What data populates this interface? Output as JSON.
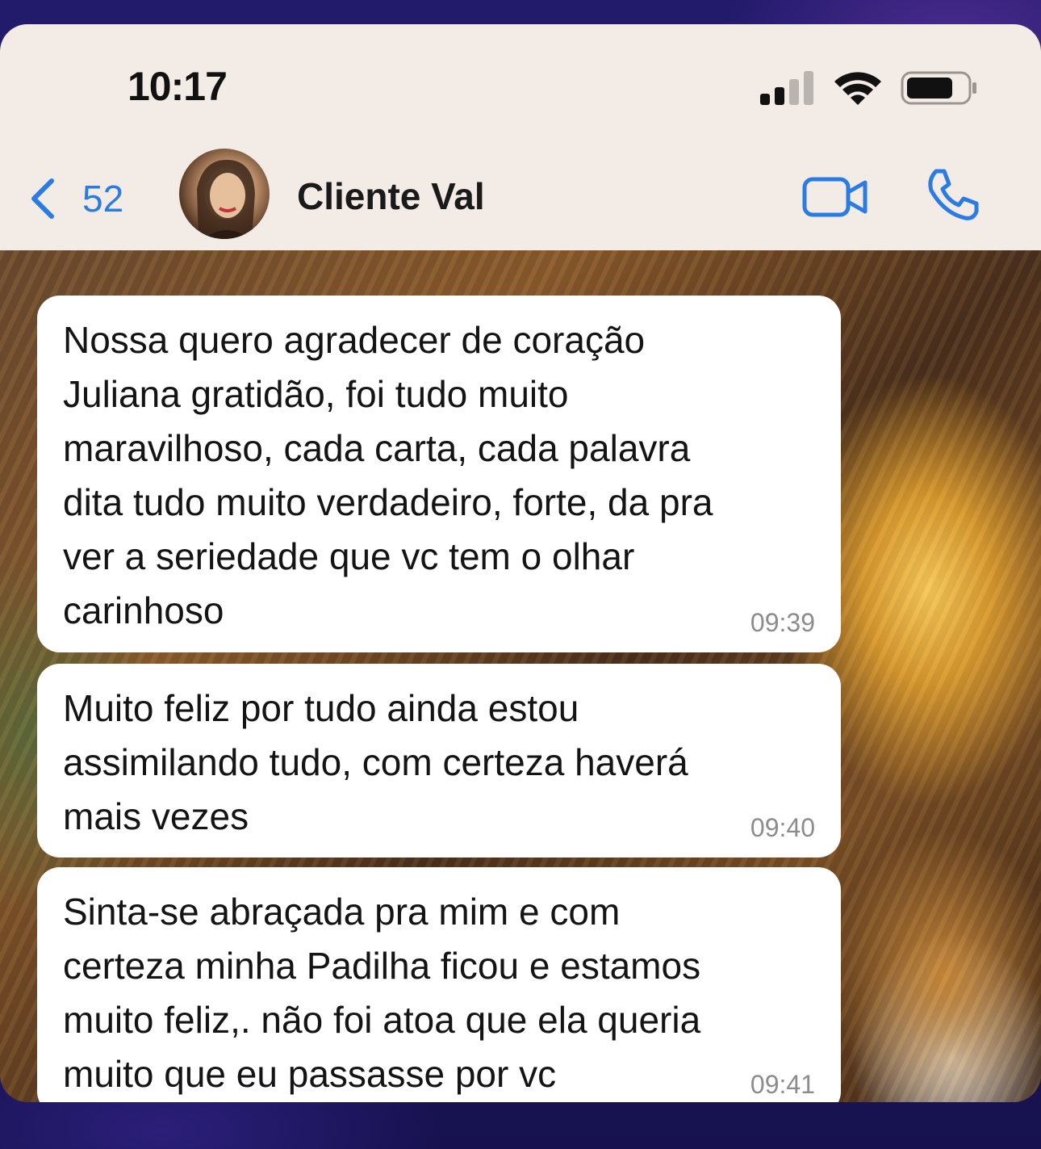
{
  "status_bar": {
    "time": "10:17"
  },
  "nav": {
    "back_count": "52",
    "contact_name": "Cliente Val"
  },
  "icons": {
    "back": "chevron-left-icon",
    "video": "video-camera-icon",
    "call": "phone-icon",
    "signal": "cellular-signal-icon",
    "wifi": "wifi-icon",
    "battery": "battery-icon"
  },
  "colors": {
    "accent": "#2a7be4",
    "bubble": "#ffffff",
    "header": "#f3ece6"
  },
  "messages": [
    {
      "text": "Nossa quero agradecer de coração\nJuliana gratidão, foi tudo muito\nmaravilhoso, cada carta, cada palavra\ndita tudo muito verdadeiro, forte, da pra\nver a seriedade que vc tem o olhar\ncarinhoso",
      "time": "09:39"
    },
    {
      "text": "Muito feliz por tudo ainda estou\nassimilando tudo, com certeza haverá\nmais vezes",
      "time": "09:40"
    },
    {
      "text": "Sinta-se abraçada pra mim e com\ncerteza minha Padilha ficou e estamos\nmuito feliz,. não foi atoa que ela queria\nmuito que eu passasse por vc",
      "time": "09:41"
    }
  ]
}
